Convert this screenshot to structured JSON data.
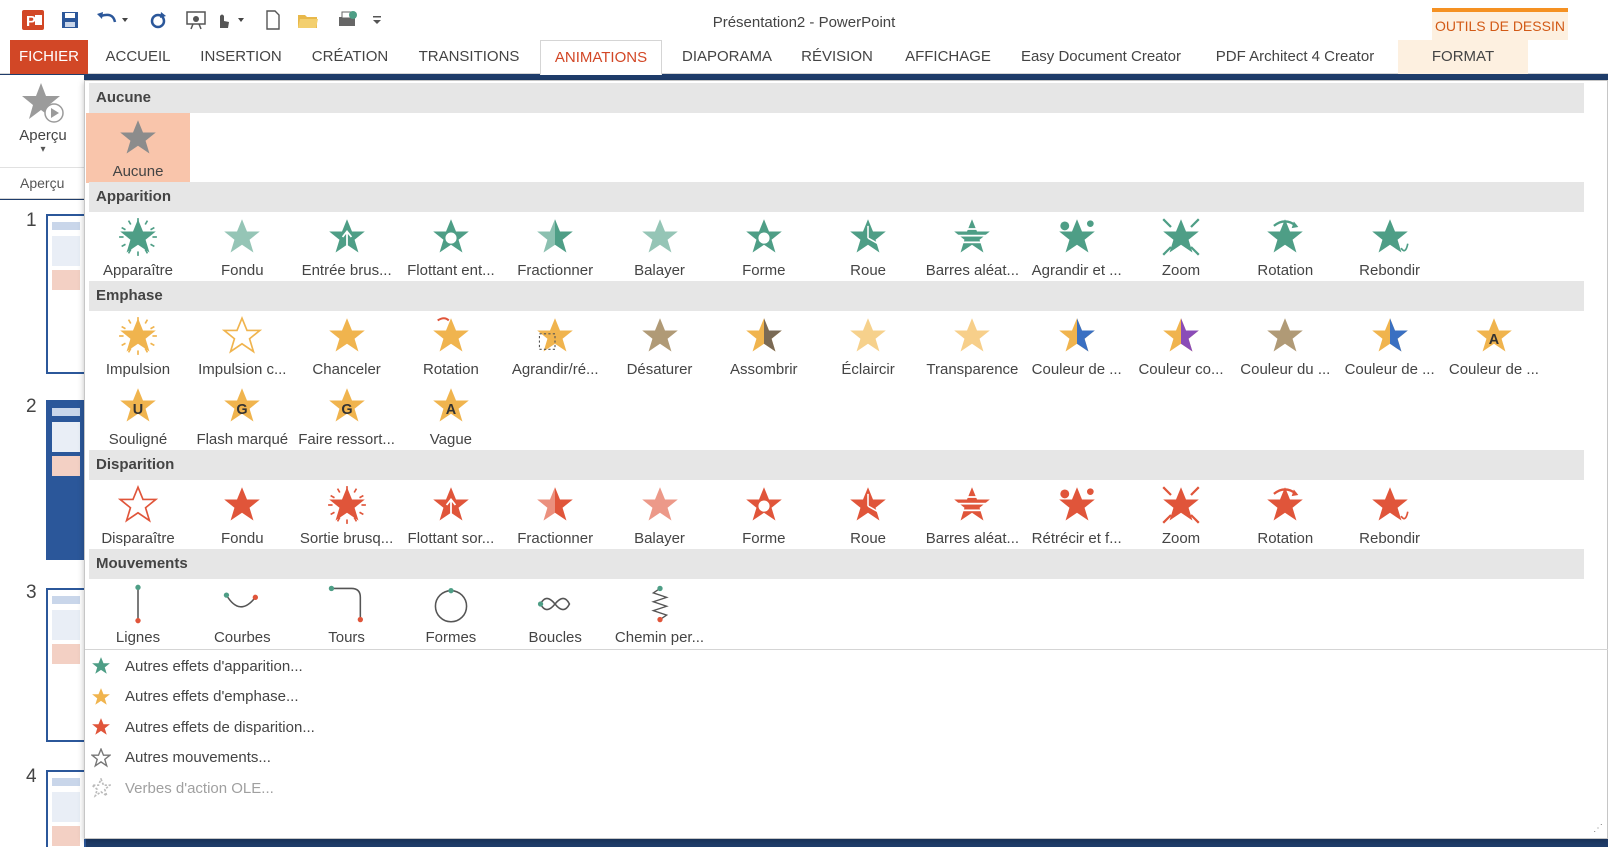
{
  "window": {
    "title": "Présentation2 - PowerPoint",
    "contextual_group": "OUTILS DE DESSIN"
  },
  "tabs": [
    "FICHIER",
    "ACCUEIL",
    "INSERTION",
    "CRÉATION",
    "TRANSITIONS",
    "ANIMATIONS",
    "DIAPORAMA",
    "RÉVISION",
    "AFFICHAGE",
    "Easy Document Creator",
    "PDF Architect 4 Creator",
    "FORMAT"
  ],
  "active_tab": "ANIMATIONS",
  "ribbon": {
    "preview_button": "Aperçu",
    "preview_group": "Aperçu"
  },
  "slides": [
    "1",
    "2",
    "3",
    "4"
  ],
  "gallery": {
    "sections": [
      {
        "title": "Aucune",
        "color": "#8c8c8c",
        "items": [
          "Aucune"
        ]
      },
      {
        "title": "Apparition",
        "color": "#4e9e86",
        "items": [
          "Apparaître",
          "Fondu",
          "Entrée brus...",
          "Flottant ent...",
          "Fractionner",
          "Balayer",
          "Forme",
          "Roue",
          "Barres aléat...",
          "Agrandir et ...",
          "Zoom",
          "Rotation",
          "Rebondir"
        ]
      },
      {
        "title": "Emphase",
        "color": "#f0b44e",
        "items": [
          "Impulsion",
          "Impulsion c...",
          "Chanceler",
          "Rotation",
          "Agrandir/ré...",
          "Désaturer",
          "Assombrir",
          "Éclaircir",
          "Transparence",
          "Couleur de ...",
          "Couleur co...",
          "Couleur du ...",
          "Couleur de ...",
          "Couleur de ...",
          "Souligné",
          "Flash marqué",
          "Faire ressort...",
          "Vague"
        ]
      },
      {
        "title": "Disparition",
        "color": "#e0553a",
        "items": [
          "Disparaître",
          "Fondu",
          "Sortie brusq...",
          "Flottant sor...",
          "Fractionner",
          "Balayer",
          "Forme",
          "Roue",
          "Barres aléat...",
          "Rétrécir et f...",
          "Zoom",
          "Rotation",
          "Rebondir"
        ]
      },
      {
        "title": "Mouvements",
        "color": "#6e6e6e",
        "items": [
          "Lignes",
          "Courbes",
          "Tours",
          "Formes",
          "Boucles",
          "Chemin per..."
        ]
      }
    ],
    "selected": "Aucune",
    "emphasis_letters": {
      "Couleur de ...": "A",
      "Souligné": "U",
      "Flash marqué": "G",
      "Faire ressort...": "G",
      "Vague": "A"
    },
    "menu": [
      {
        "label": "Autres effets d'apparition...",
        "icon": "green-star-icon",
        "color": "#4e9e86",
        "disabled": false
      },
      {
        "label": "Autres effets d'emphase...",
        "icon": "gold-star-icon",
        "color": "#f0b44e",
        "disabled": false
      },
      {
        "label": "Autres effets de disparition...",
        "icon": "red-star-icon",
        "color": "#e0553a",
        "disabled": false
      },
      {
        "label": "Autres mouvements...",
        "icon": "outline-star-icon",
        "color": "#777777",
        "disabled": false
      },
      {
        "label": "Verbes d'action OLE...",
        "icon": "gears-icon",
        "color": "#bbbbbb",
        "disabled": true
      }
    ]
  }
}
